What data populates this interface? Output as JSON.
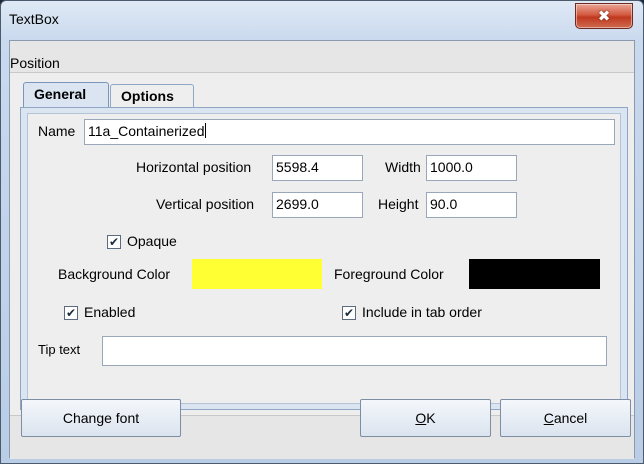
{
  "window": {
    "title": "TextBox",
    "close_symbol": "✖"
  },
  "menu": {
    "position_label": "Position"
  },
  "tabs": [
    {
      "label": "General",
      "selected": true
    },
    {
      "label": "Options",
      "selected": false
    }
  ],
  "form": {
    "name_label": "Name",
    "name_value": "11a_Containerized",
    "horizontal_label": "Horizontal position",
    "horizontal_value": "5598.4",
    "width_label": "Width",
    "width_value": "1000.0",
    "vertical_label": "Vertical position",
    "vertical_value": "2699.0",
    "height_label": "Height",
    "height_value": "90.0",
    "opaque_label": "Opaque",
    "opaque_checked": true,
    "background_label": "Background Color",
    "background_color": "#ffff33",
    "foreground_label": "Foreground Color",
    "foreground_color": "#000000",
    "enabled_label": "Enabled",
    "enabled_checked": true,
    "taborder_label": "Include in tab order",
    "taborder_checked": true,
    "tiptext_label": "Tip text",
    "tiptext_value": ""
  },
  "buttons": {
    "change_font": "Change font",
    "ok_mnemonic": "O",
    "ok_rest": "K",
    "cancel_mnemonic": "C",
    "cancel_rest": "ancel"
  },
  "check_mark": "✔"
}
